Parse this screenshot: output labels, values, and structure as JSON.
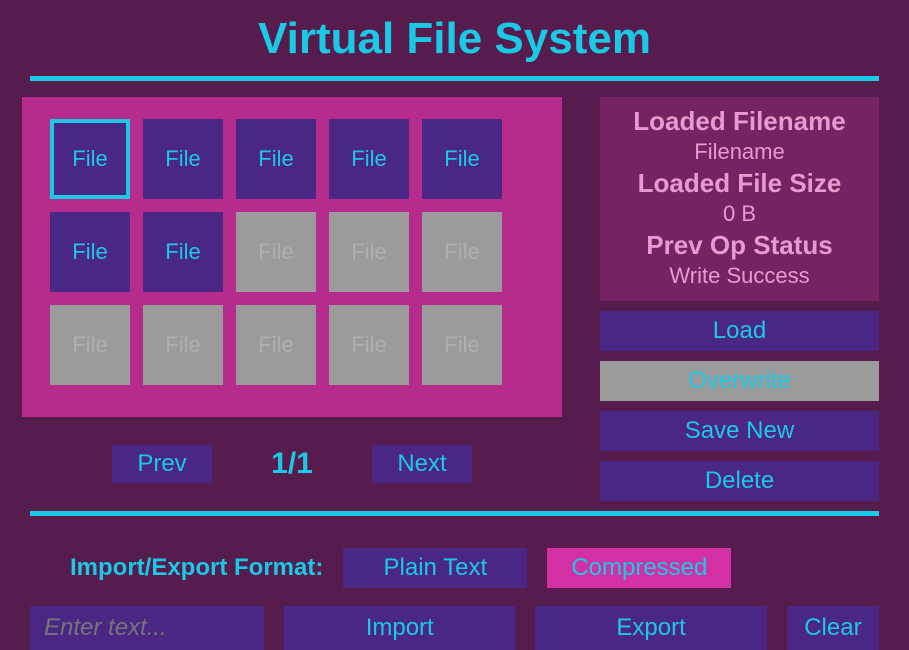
{
  "title": "Virtual File System",
  "grid": {
    "cells": [
      {
        "label": "File",
        "state": "selected"
      },
      {
        "label": "File",
        "state": "active"
      },
      {
        "label": "File",
        "state": "active"
      },
      {
        "label": "File",
        "state": "active"
      },
      {
        "label": "File",
        "state": "active"
      },
      {
        "label": "File",
        "state": "active"
      },
      {
        "label": "File",
        "state": "active"
      },
      {
        "label": "File",
        "state": "empty"
      },
      {
        "label": "File",
        "state": "empty"
      },
      {
        "label": "File",
        "state": "empty"
      },
      {
        "label": "File",
        "state": "empty"
      },
      {
        "label": "File",
        "state": "empty"
      },
      {
        "label": "File",
        "state": "empty"
      },
      {
        "label": "File",
        "state": "empty"
      },
      {
        "label": "File",
        "state": "empty"
      }
    ]
  },
  "paging": {
    "prev": "Prev",
    "next": "Next",
    "count": "1/1"
  },
  "info": {
    "filename_label": "Loaded Filename",
    "filename_value": "Filename",
    "filesize_label": "Loaded File Size",
    "filesize_value": "0 B",
    "status_label": "Prev Op Status",
    "status_value": "Write Success"
  },
  "actions": {
    "load": "Load",
    "overwrite": "Overwrite",
    "savenew": "Save New",
    "delete": "Delete"
  },
  "format": {
    "label": "Import/Export Format:",
    "plain": "Plain Text",
    "compressed": "Compressed"
  },
  "io": {
    "placeholder": "Enter text...",
    "import": "Import",
    "export": "Export",
    "clear": "Clear"
  }
}
